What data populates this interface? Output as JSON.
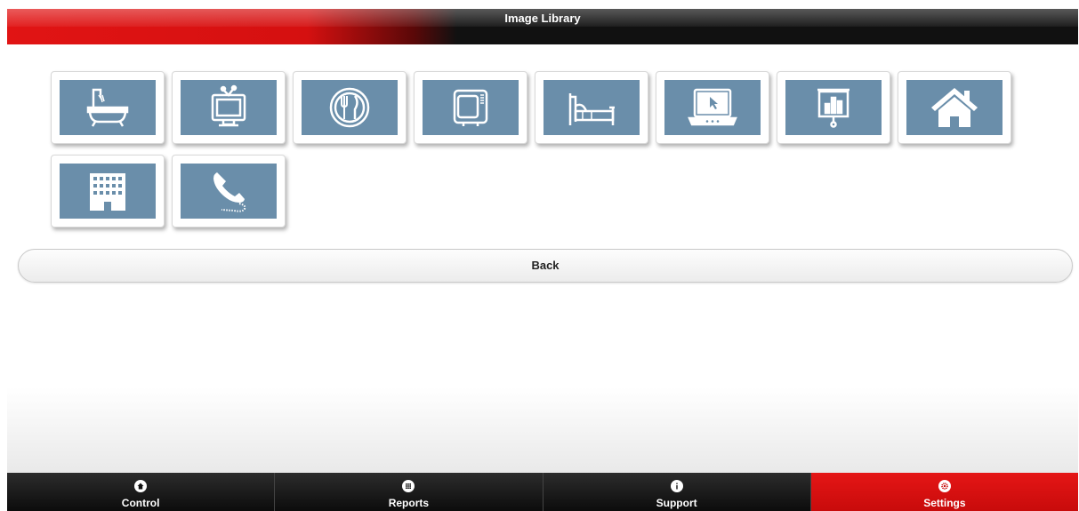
{
  "header": {
    "title": "Image Library"
  },
  "library": {
    "images": [
      {
        "icon": "bathtub-icon"
      },
      {
        "icon": "tv-icon"
      },
      {
        "icon": "dining-icon"
      },
      {
        "icon": "microwave-icon"
      },
      {
        "icon": "bed-icon"
      },
      {
        "icon": "laptop-icon"
      },
      {
        "icon": "presentation-icon"
      },
      {
        "icon": "house-icon"
      },
      {
        "icon": "building-icon"
      },
      {
        "icon": "phone-icon"
      }
    ]
  },
  "actions": {
    "back_label": "Back"
  },
  "nav": {
    "items": [
      {
        "label": "Control",
        "icon": "home-icon",
        "active": false
      },
      {
        "label": "Reports",
        "icon": "grid-icon",
        "active": false
      },
      {
        "label": "Support",
        "icon": "info-icon",
        "active": false
      },
      {
        "label": "Settings",
        "icon": "gear-icon",
        "active": true
      }
    ]
  },
  "colors": {
    "accent_red": "#e11414",
    "tile_face": "#6a8eaa",
    "header_dark": "#111111"
  }
}
